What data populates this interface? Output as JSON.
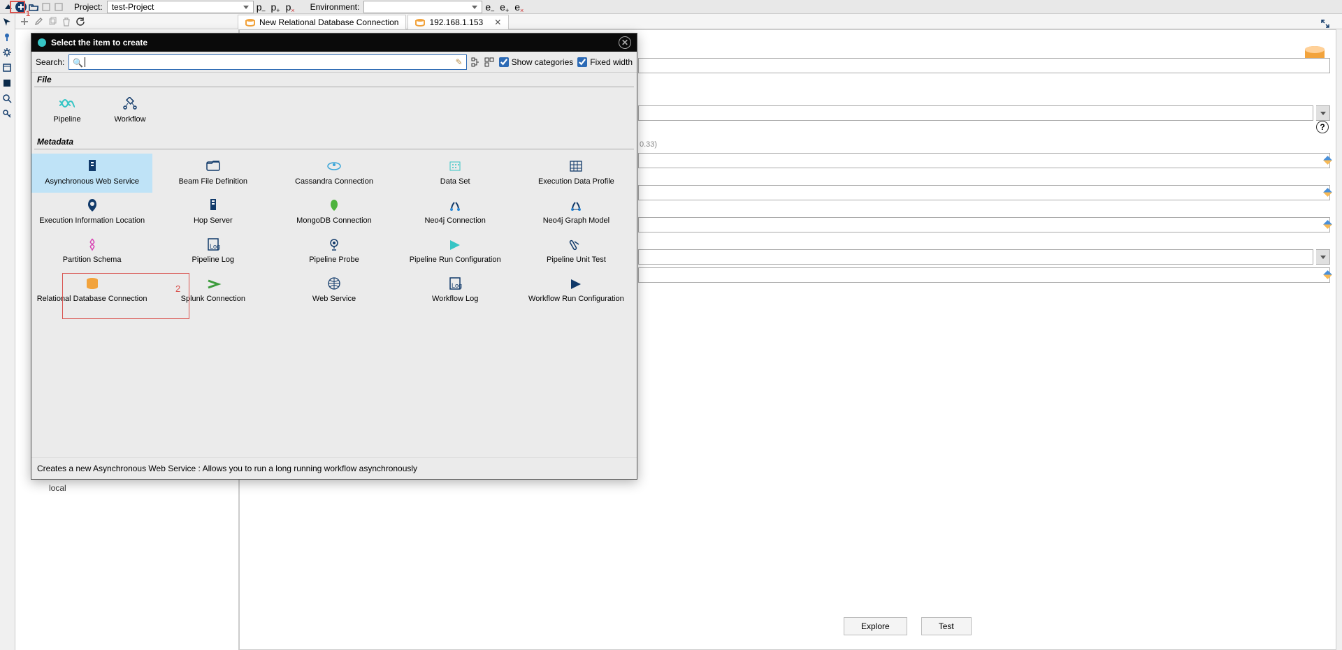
{
  "toolbar": {
    "project_label": "Project:",
    "project_value": "test-Project",
    "env_label": "Environment:",
    "shorts": {
      "p": "p",
      "e": "e",
      "plus": "+",
      "minus": "‒",
      "x": "×"
    }
  },
  "tabs": {
    "new_conn": "New Relational Database Connection",
    "ip": "192.168.1.153"
  },
  "sidebar": {
    "local": "local"
  },
  "dialog": {
    "title": "Select the item to create",
    "search_label": "Search:",
    "show_categories": "Show categories",
    "fixed_width": "Fixed width",
    "section_file": "File",
    "section_metadata": "Metadata",
    "file_items": [
      "Pipeline",
      "Workflow"
    ],
    "metadata_items": [
      "Asynchronous Web Service",
      "Beam File Definition",
      "Cassandra Connection",
      "Data Set",
      "Execution Data Profile",
      "Execution Information Location",
      "Hop Server",
      "MongoDB Connection",
      "Neo4j Connection",
      "Neo4j Graph Model",
      "Partition Schema",
      "Pipeline Log",
      "Pipeline Probe",
      "Pipeline Run Configuration",
      "Pipeline Unit Test",
      "Relational Database Connection",
      "Splunk Connection",
      "Web Service",
      "Workflow Log",
      "Workflow Run Configuration"
    ],
    "description": "Creates a new Asynchronous Web Service : Allows you to run a long running workflow asynchronously"
  },
  "form": {
    "hint": "0.33)"
  },
  "buttons": {
    "explore": "Explore",
    "test": "Test"
  },
  "annotations": {
    "n1": "1",
    "n2": "2"
  }
}
